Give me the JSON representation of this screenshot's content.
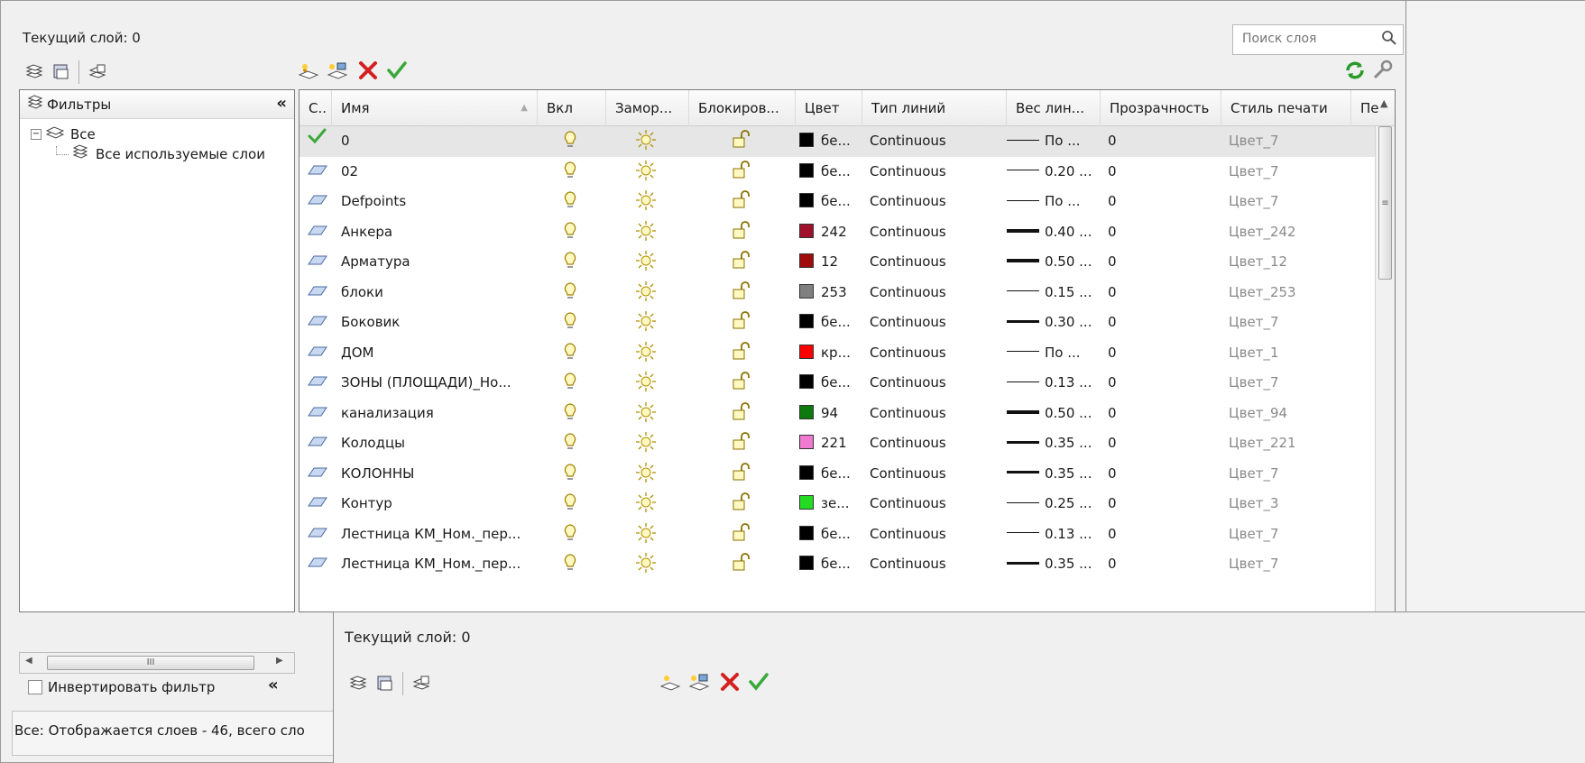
{
  "header": {
    "current_layer": "Текущий слой: 0",
    "search_placeholder": "Поиск слоя"
  },
  "filters": {
    "title": "Фильтры",
    "collapse_label": "«",
    "tree": [
      {
        "label": "Все",
        "icon": "layer-stack-icon"
      },
      {
        "label": "Все используемые слои",
        "icon": "filter-icon"
      }
    ],
    "invert_label": "Инвертировать фильтр",
    "scroll_grip": "III"
  },
  "status": {
    "text": "Все: Отображается слоев - 46, всего сло"
  },
  "columns": [
    "С..",
    "Имя",
    "Вкл",
    "Замор...",
    "Блокиров...",
    "Цвет",
    "Тип линий",
    "Вес лин...",
    "Прозрачность",
    "Стиль печати",
    "Пе"
  ],
  "layers": [
    {
      "name": "0",
      "current": true,
      "color_label": "бе...",
      "color_hex": "#000000",
      "linetype": "Continuous",
      "lineweight": "По ...",
      "lw_thick": 1,
      "transparency": "0",
      "plot_style": "Цвет_7"
    },
    {
      "name": "02",
      "color_label": "бе...",
      "color_hex": "#000000",
      "linetype": "Continuous",
      "lineweight": "0.20 ...",
      "lw_thick": 1,
      "transparency": "0",
      "plot_style": "Цвет_7"
    },
    {
      "name": "Defpoints",
      "color_label": "бе...",
      "color_hex": "#000000",
      "linetype": "Continuous",
      "lineweight": "По ...",
      "lw_thick": 1,
      "transparency": "0",
      "plot_style": "Цвет_7"
    },
    {
      "name": "Анкера",
      "color_label": "242",
      "color_hex": "#a0102a",
      "linetype": "Continuous",
      "lineweight": "0.40 ...",
      "lw_thick": 4,
      "transparency": "0",
      "plot_style": "Цвет_242"
    },
    {
      "name": "Арматура",
      "color_label": "12",
      "color_hex": "#a00c0c",
      "linetype": "Continuous",
      "lineweight": "0.50 ...",
      "lw_thick": 4,
      "transparency": "0",
      "plot_style": "Цвет_12"
    },
    {
      "name": "блоки",
      "color_label": "253",
      "color_hex": "#808080",
      "linetype": "Continuous",
      "lineweight": "0.15 ...",
      "lw_thick": 1,
      "transparency": "0",
      "plot_style": "Цвет_253"
    },
    {
      "name": "Боковик",
      "color_label": "бе...",
      "color_hex": "#000000",
      "linetype": "Continuous",
      "lineweight": "0.30 ...",
      "lw_thick": 3,
      "transparency": "0",
      "plot_style": "Цвет_7"
    },
    {
      "name": "ДОМ",
      "color_label": "кр...",
      "color_hex": "#ff0000",
      "linetype": "Continuous",
      "lineweight": "По ...",
      "lw_thick": 1,
      "transparency": "0",
      "plot_style": "Цвет_1"
    },
    {
      "name": "ЗОНЫ (ПЛОЩАДИ)_Но...",
      "color_label": "бе...",
      "color_hex": "#000000",
      "linetype": "Continuous",
      "lineweight": "0.13 ...",
      "lw_thick": 1,
      "transparency": "0",
      "plot_style": "Цвет_7"
    },
    {
      "name": "канализация",
      "color_label": "94",
      "color_hex": "#0c7a0c",
      "linetype": "Continuous",
      "lineweight": "0.50 ...",
      "lw_thick": 4,
      "transparency": "0",
      "plot_style": "Цвет_94"
    },
    {
      "name": "Колодцы",
      "color_label": "221",
      "color_hex": "#f07ad0",
      "linetype": "Continuous",
      "lineweight": "0.35 ...",
      "lw_thick": 3,
      "transparency": "0",
      "plot_style": "Цвет_221"
    },
    {
      "name": "КОЛОННЫ",
      "color_label": "бе...",
      "color_hex": "#000000",
      "linetype": "Continuous",
      "lineweight": "0.35 ...",
      "lw_thick": 3,
      "transparency": "0",
      "plot_style": "Цвет_7"
    },
    {
      "name": "Контур",
      "color_label": "зе...",
      "color_hex": "#22dd22",
      "linetype": "Continuous",
      "lineweight": "0.25 ...",
      "lw_thick": 1,
      "transparency": "0",
      "plot_style": "Цвет_3"
    },
    {
      "name": "Лестница КМ_Ном._пер...",
      "color_label": "бе...",
      "color_hex": "#000000",
      "linetype": "Continuous",
      "lineweight": "0.13 ...",
      "lw_thick": 1,
      "transparency": "0",
      "plot_style": "Цвет_7"
    },
    {
      "name": "Лестница КМ_Ном._пер...",
      "color_label": "бе...",
      "color_hex": "#000000",
      "linetype": "Continuous",
      "lineweight": "0.35 ...",
      "lw_thick": 3,
      "transparency": "0",
      "plot_style": "Цвет_7"
    }
  ],
  "overlay": {
    "current_layer": "Текущий слой: 0"
  },
  "colors": {
    "accent_green": "#3aa83a",
    "delete_red": "#d42020",
    "bulb": "#d8c000",
    "sun": "#e0c020"
  }
}
